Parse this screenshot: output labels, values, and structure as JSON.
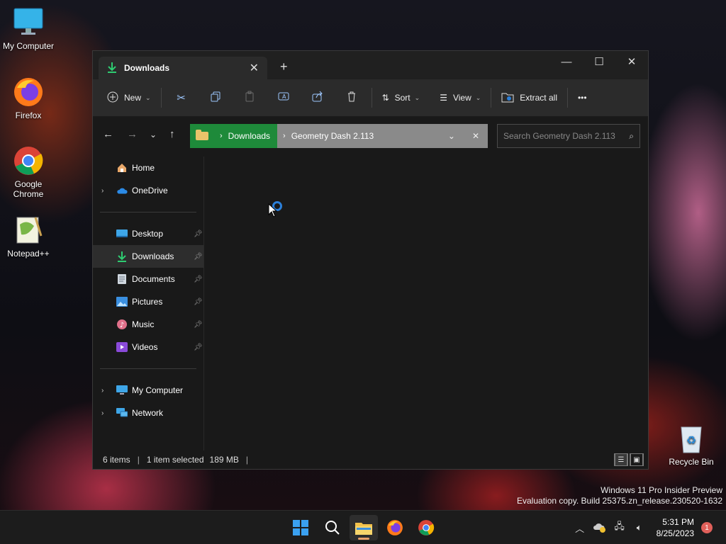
{
  "desktop": {
    "icons": [
      {
        "label": "My Computer"
      },
      {
        "label": "Firefox"
      },
      {
        "label": "Google Chrome"
      },
      {
        "label": "Notepad++"
      },
      {
        "label": "Recycle Bin"
      }
    ]
  },
  "window": {
    "tab_title": "Downloads",
    "tab_close": "✕",
    "new_tab": "+",
    "controls": {
      "minimize": "—",
      "maximize": "☐",
      "close": "✕"
    }
  },
  "toolbar": {
    "new_label": "New",
    "sort_label": "Sort",
    "view_label": "View",
    "extract_label": "Extract all",
    "more_label": "•••"
  },
  "address": {
    "crumbs": [
      "Downloads",
      "Geometry Dash 2.113"
    ],
    "search_placeholder": "Search Geometry Dash 2.113"
  },
  "sidebar": {
    "top": [
      {
        "label": "Home"
      },
      {
        "label": "OneDrive"
      }
    ],
    "pinned": [
      {
        "label": "Desktop"
      },
      {
        "label": "Downloads"
      },
      {
        "label": "Documents"
      },
      {
        "label": "Pictures"
      },
      {
        "label": "Music"
      },
      {
        "label": "Videos"
      }
    ],
    "bottom": [
      {
        "label": "My Computer"
      },
      {
        "label": "Network"
      }
    ]
  },
  "status": {
    "items": "6 items",
    "selected": "1 item selected",
    "size": "189 MB"
  },
  "watermark": {
    "line1": "Windows 11 Pro Insider Preview",
    "line2": "Evaluation copy. Build 25375.zn_release.230520-1632"
  },
  "taskbar": {
    "time": "5:31 PM",
    "date": "8/25/2023",
    "notifications": "1"
  },
  "colors": {
    "accent": "#1e8a3a",
    "spinner": "#2b7fd9",
    "window_bg": "#191919",
    "toolbar_bg": "#2b2b2b"
  }
}
